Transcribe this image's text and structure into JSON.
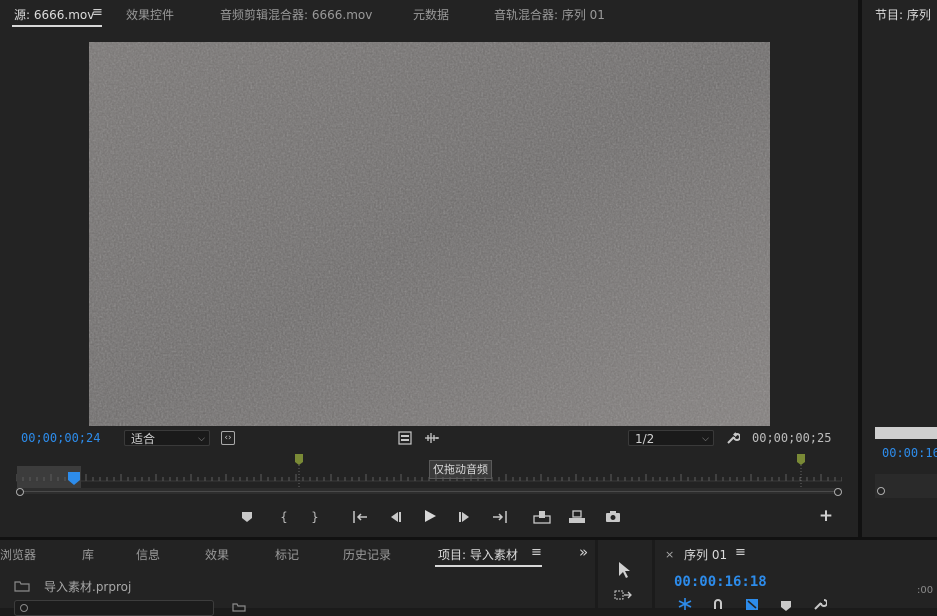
{
  "source_panel": {
    "tabs": [
      {
        "label": "源: 6666.mov",
        "active": true
      },
      {
        "label": "效果控件",
        "active": false
      },
      {
        "label": "音频剪辑混合器: 6666.mov",
        "active": false
      },
      {
        "label": "元数据",
        "active": false
      },
      {
        "label": "音轨混合器: 序列 01",
        "active": false
      }
    ],
    "menu_icon": "≡",
    "timecode_current": "00;00;00;24",
    "timecode_duration": "00;00;00;25",
    "zoom_select": "适合",
    "resolution_select": "1/2",
    "tooltip": "仅拖动音频",
    "playhead_position": 0.07
  },
  "program_panel": {
    "tab_label": "节目: 序列",
    "timecode": "00:00:16"
  },
  "project_panel": {
    "tabs": [
      {
        "label": "浏览器",
        "active": false
      },
      {
        "label": "库",
        "active": false
      },
      {
        "label": "信息",
        "active": false
      },
      {
        "label": "效果",
        "active": false
      },
      {
        "label": "标记",
        "active": false
      },
      {
        "label": "历史记录",
        "active": false
      },
      {
        "label": "项目: 导入素材",
        "active": true
      }
    ],
    "menu_icon": "≡",
    "overflow_icon": "»",
    "project_file": "导入素材.prproj"
  },
  "timeline_panel": {
    "close_icon": "×",
    "tab_label": "序列 01",
    "menu_icon": "≡",
    "timecode": "00:00:16:18"
  },
  "colors": {
    "accent_blue": "#2d8ceb",
    "marker_green": "#7a8a36",
    "panel_bg": "#232323",
    "app_bg": "#1b1b1b"
  }
}
